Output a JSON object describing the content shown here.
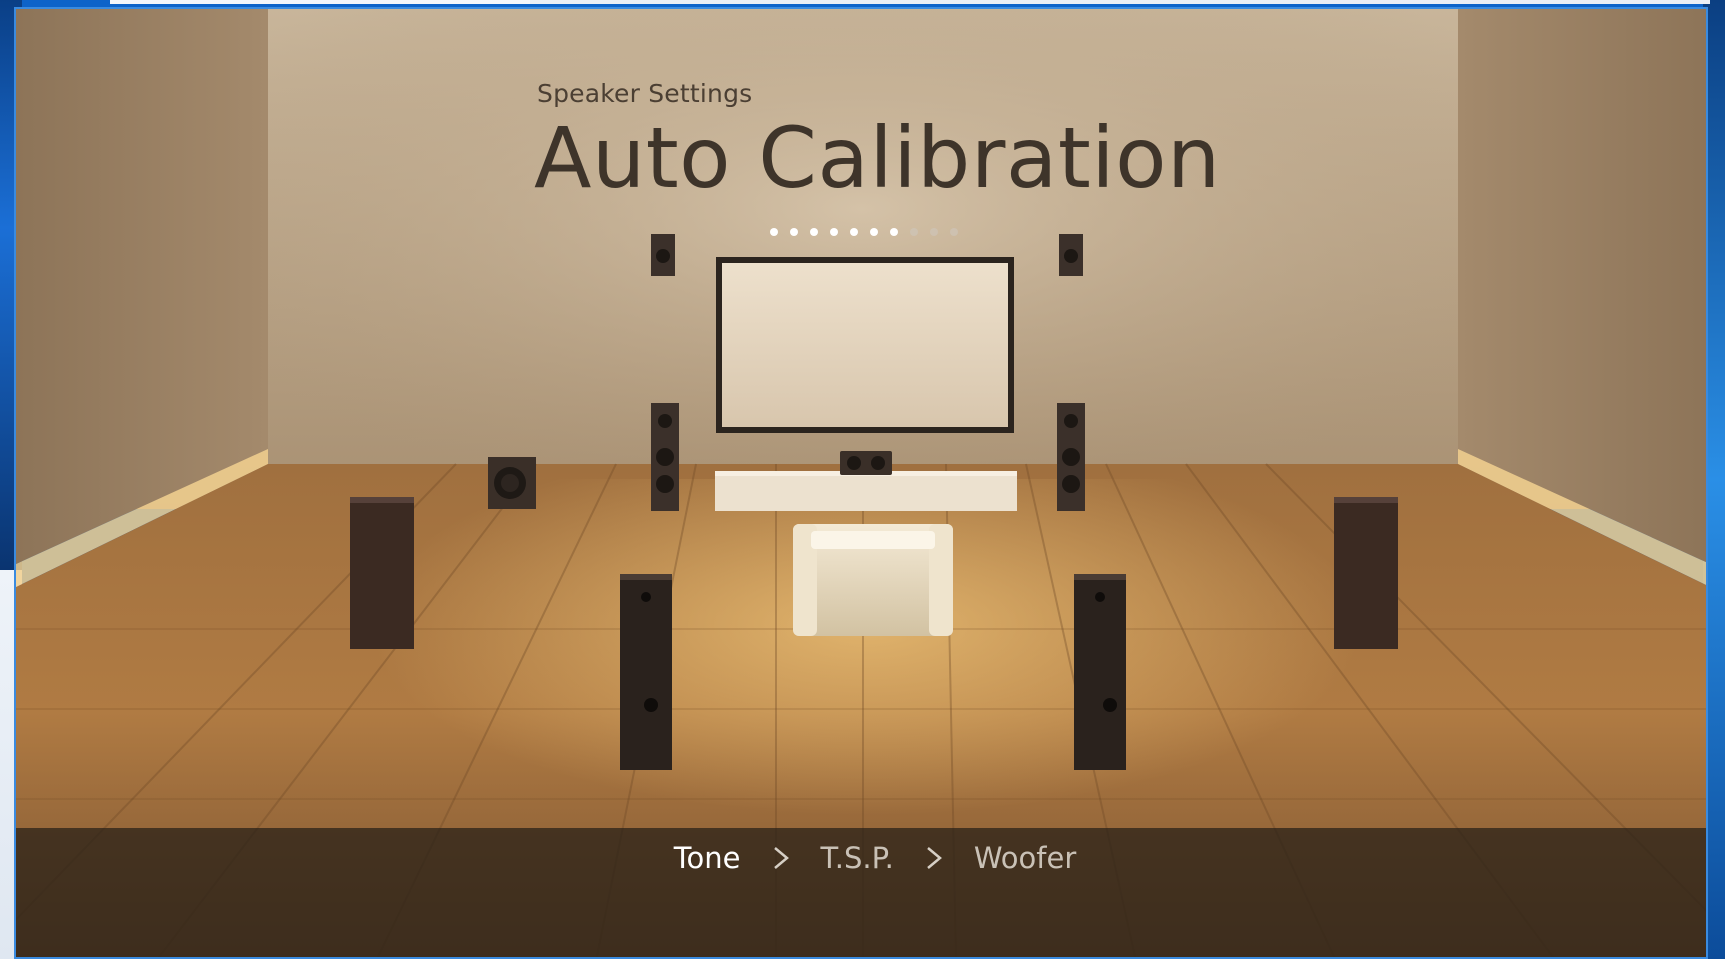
{
  "window": {
    "subtitle": "Speaker Settings",
    "title": "Auto Calibration"
  },
  "progress": {
    "total_steps": 10,
    "completed_steps": 7,
    "active_color": "#ffffff",
    "inactive_color": "#cfc7bc"
  },
  "steps": [
    {
      "label": "Tone",
      "active": true
    },
    {
      "label": "T.S.P.",
      "active": false
    },
    {
      "label": "Woofer",
      "active": false
    }
  ],
  "icons": {
    "step_separator": "chevron-right-icon"
  },
  "colors": {
    "wall": "#b9a589",
    "floor": "#a8743e",
    "title_text": "#3e342a"
  }
}
